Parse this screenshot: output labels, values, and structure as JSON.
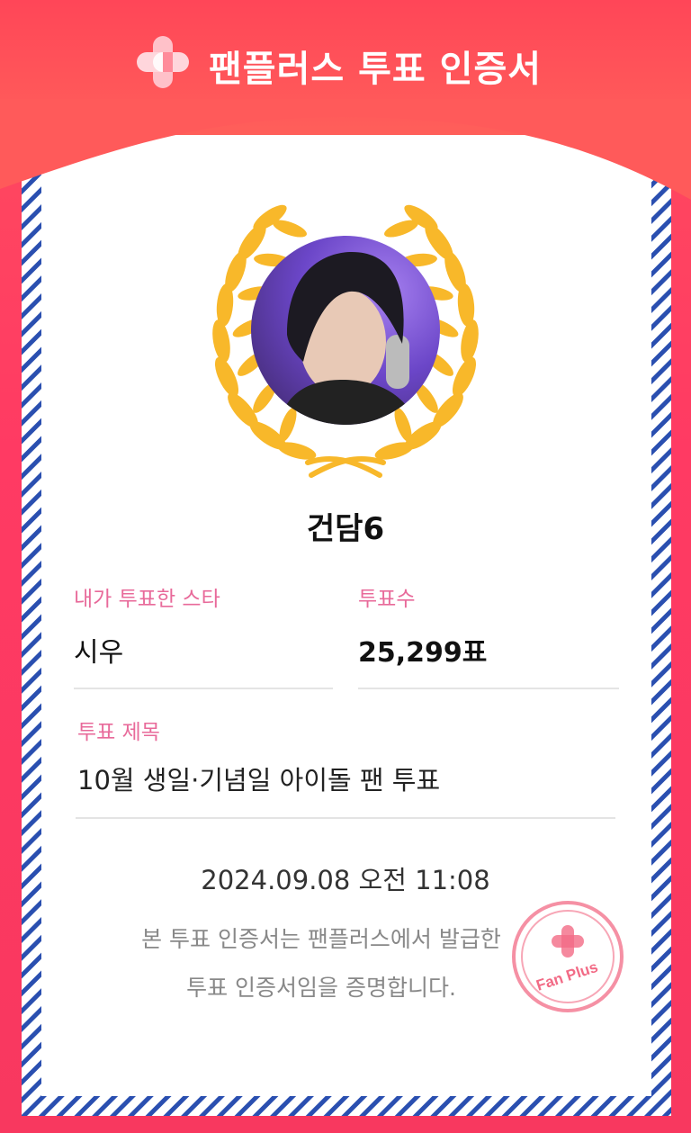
{
  "header": {
    "title": "팬플러스 투표 인증서",
    "logo_icon": "fanplus-cross-icon"
  },
  "certificate": {
    "group_name": "건담6",
    "star_label": "내가 투표한 스타",
    "star_value": "시우",
    "votes_label": "투표수",
    "votes_value": "25,299표",
    "vote_title_label": "투표 제목",
    "vote_title_value": "10월 생일·기념일 아이돌 팬 투표",
    "datetime": "2024.09.08 오전 11:08",
    "statement_line1": "본 투표 인증서는 팬플러스에서 발급한",
    "statement_line2": "투표 인증서임을 증명합니다.",
    "stamp_text": "Fan Plus"
  },
  "colors": {
    "brand_red": "#ff4658",
    "label_pink": "#e86a9a",
    "laurel_gold": "#f8b82a",
    "stripe_blue": "#2a4fb0"
  }
}
